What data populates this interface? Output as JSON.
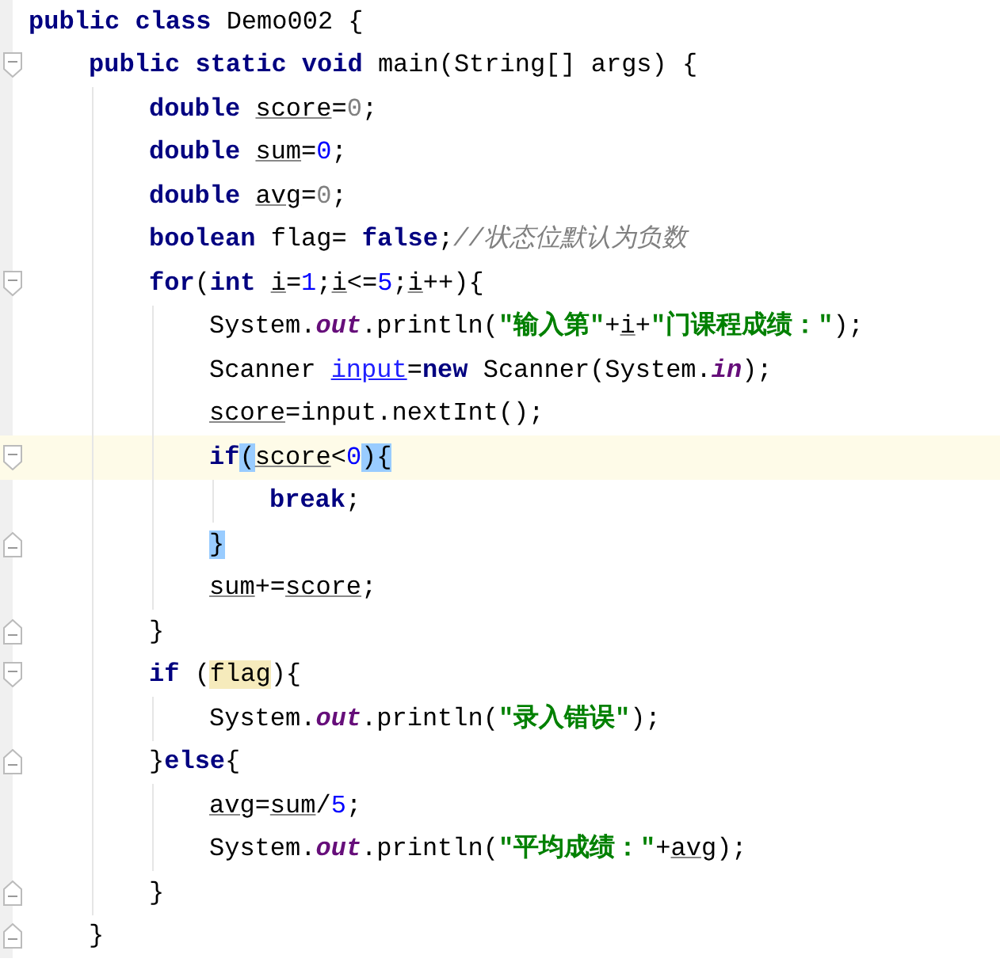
{
  "lines": [
    {
      "current": false,
      "tokens": [
        {
          "kind": "keyword",
          "text": "public class "
        },
        {
          "kind": "plain",
          "text": "Demo002 {"
        }
      ],
      "children": [
        {
          "kind": "opener",
          "current": false,
          "tokens": [
            {
              "kind": "keyword",
              "text": "public static void "
            },
            {
              "kind": "plain",
              "text": "main(String[] args) {"
            }
          ],
          "children": [
            {
              "current": false,
              "tokens": [
                {
                  "kind": "keyword",
                  "text": "double "
                },
                {
                  "kind": "var",
                  "text": "score"
                },
                {
                  "kind": "plain",
                  "text": "="
                },
                {
                  "kind": "muted",
                  "text": "0"
                },
                {
                  "kind": "plain",
                  "text": ";"
                }
              ]
            },
            {
              "current": false,
              "tokens": [
                {
                  "kind": "keyword",
                  "text": "double "
                },
                {
                  "kind": "var",
                  "text": "sum"
                },
                {
                  "kind": "plain",
                  "text": "="
                },
                {
                  "kind": "number",
                  "text": "0"
                },
                {
                  "kind": "plain",
                  "text": ";"
                }
              ]
            },
            {
              "current": false,
              "tokens": [
                {
                  "kind": "keyword",
                  "text": "double "
                },
                {
                  "kind": "var",
                  "text": "avg"
                },
                {
                  "kind": "plain",
                  "text": "="
                },
                {
                  "kind": "muted",
                  "text": "0"
                },
                {
                  "kind": "plain",
                  "text": ";"
                }
              ]
            },
            {
              "current": false,
              "tokens": [
                {
                  "kind": "keyword",
                  "text": "boolean "
                },
                {
                  "kind": "plain",
                  "text": "flag= "
                },
                {
                  "kind": "keyword",
                  "text": "false"
                },
                {
                  "kind": "plain",
                  "text": ";"
                },
                {
                  "kind": "comment",
                  "text": "//状态位默认为负数"
                }
              ]
            },
            {
              "kind": "opener",
              "current": false,
              "tokens": [
                {
                  "kind": "keyword",
                  "text": "for"
                },
                {
                  "kind": "plain",
                  "text": "("
                },
                {
                  "kind": "keyword",
                  "text": "int "
                },
                {
                  "kind": "var",
                  "text": "i"
                },
                {
                  "kind": "plain",
                  "text": "="
                },
                {
                  "kind": "number",
                  "text": "1"
                },
                {
                  "kind": "plain",
                  "text": ";"
                },
                {
                  "kind": "var",
                  "text": "i"
                },
                {
                  "kind": "plain",
                  "text": "<="
                },
                {
                  "kind": "number",
                  "text": "5"
                },
                {
                  "kind": "plain",
                  "text": ";"
                },
                {
                  "kind": "var",
                  "text": "i"
                },
                {
                  "kind": "plain",
                  "text": "++){"
                }
              ],
              "children": [
                {
                  "current": false,
                  "tokens": [
                    {
                      "kind": "plain",
                      "text": "System."
                    },
                    {
                      "kind": "field",
                      "text": "out"
                    },
                    {
                      "kind": "plain",
                      "text": ".println("
                    },
                    {
                      "kind": "string",
                      "text": "\"输入第\""
                    },
                    {
                      "kind": "plain",
                      "text": "+"
                    },
                    {
                      "kind": "var",
                      "text": "i"
                    },
                    {
                      "kind": "plain",
                      "text": "+"
                    },
                    {
                      "kind": "string",
                      "text": "\"门课程成绩：\""
                    },
                    {
                      "kind": "plain",
                      "text": ");"
                    }
                  ]
                },
                {
                  "current": false,
                  "tokens": [
                    {
                      "kind": "plain",
                      "text": "Scanner "
                    },
                    {
                      "kind": "ref",
                      "text": "input"
                    },
                    {
                      "kind": "plain",
                      "text": "="
                    },
                    {
                      "kind": "keyword",
                      "text": "new"
                    },
                    {
                      "kind": "plain",
                      "text": " Scanner(System."
                    },
                    {
                      "kind": "field",
                      "text": "in"
                    },
                    {
                      "kind": "plain",
                      "text": ");"
                    }
                  ]
                },
                {
                  "current": false,
                  "tokens": [
                    {
                      "kind": "var",
                      "text": "score"
                    },
                    {
                      "kind": "plain",
                      "text": "=input.nextInt();"
                    }
                  ]
                },
                {
                  "kind": "opener",
                  "current": true,
                  "tokens": [
                    {
                      "kind": "keyword",
                      "text": "if"
                    },
                    {
                      "kind": "brace-match",
                      "text": "("
                    },
                    {
                      "kind": "var",
                      "text": "score"
                    },
                    {
                      "kind": "plain",
                      "text": "<"
                    },
                    {
                      "kind": "number",
                      "text": "0"
                    },
                    {
                      "kind": "brace-match",
                      "text": "){"
                    }
                  ],
                  "children": [
                    {
                      "current": false,
                      "tokens": [
                        {
                          "kind": "keyword",
                          "text": "break"
                        },
                        {
                          "kind": "plain",
                          "text": ";"
                        }
                      ]
                    }
                  ]
                },
                {
                  "kind": "closer",
                  "current": false,
                  "tokens": [
                    {
                      "kind": "brace-match",
                      "text": "}"
                    }
                  ]
                },
                {
                  "current": false,
                  "tokens": [
                    {
                      "kind": "var",
                      "text": "sum"
                    },
                    {
                      "kind": "plain",
                      "text": "+="
                    },
                    {
                      "kind": "var",
                      "text": "score"
                    },
                    {
                      "kind": "plain",
                      "text": ";"
                    }
                  ]
                }
              ]
            },
            {
              "kind": "closer",
              "current": false,
              "tokens": [
                {
                  "kind": "plain",
                  "text": "}"
                }
              ]
            },
            {
              "kind": "opener",
              "current": false,
              "tokens": [
                {
                  "kind": "keyword",
                  "text": "if "
                },
                {
                  "kind": "plain",
                  "text": "("
                },
                {
                  "kind": "usage",
                  "text": "flag"
                },
                {
                  "kind": "plain",
                  "text": "){"
                }
              ],
              "children": [
                {
                  "current": false,
                  "tokens": [
                    {
                      "kind": "plain",
                      "text": "System."
                    },
                    {
                      "kind": "field",
                      "text": "out"
                    },
                    {
                      "kind": "plain",
                      "text": ".println("
                    },
                    {
                      "kind": "string",
                      "text": "\"录入错误\""
                    },
                    {
                      "kind": "plain",
                      "text": ");"
                    }
                  ]
                }
              ]
            },
            {
              "kind": "closer",
              "current": false,
              "tokens": [
                {
                  "kind": "plain",
                  "text": "}"
                },
                {
                  "kind": "keyword",
                  "text": "else"
                },
                {
                  "kind": "plain",
                  "text": "{"
                }
              ],
              "children": [
                {
                  "current": false,
                  "tokens": [
                    {
                      "kind": "var",
                      "text": "avg"
                    },
                    {
                      "kind": "plain",
                      "text": "="
                    },
                    {
                      "kind": "var",
                      "text": "sum"
                    },
                    {
                      "kind": "plain",
                      "text": "/"
                    },
                    {
                      "kind": "number",
                      "text": "5"
                    },
                    {
                      "kind": "plain",
                      "text": ";"
                    }
                  ]
                },
                {
                  "current": false,
                  "tokens": [
                    {
                      "kind": "plain",
                      "text": "System."
                    },
                    {
                      "kind": "field",
                      "text": "out"
                    },
                    {
                      "kind": "plain",
                      "text": ".println("
                    },
                    {
                      "kind": "string",
                      "text": "\"平均成绩：\""
                    },
                    {
                      "kind": "plain",
                      "text": "+"
                    },
                    {
                      "kind": "var",
                      "text": "avg"
                    },
                    {
                      "kind": "plain",
                      "text": ");"
                    }
                  ]
                }
              ]
            },
            {
              "kind": "closer",
              "current": false,
              "tokens": [
                {
                  "kind": "plain",
                  "text": "}"
                }
              ]
            }
          ]
        },
        {
          "kind": "closer",
          "current": false,
          "tokens": [
            {
              "kind": "plain",
              "text": "}"
            }
          ]
        }
      ]
    }
  ]
}
